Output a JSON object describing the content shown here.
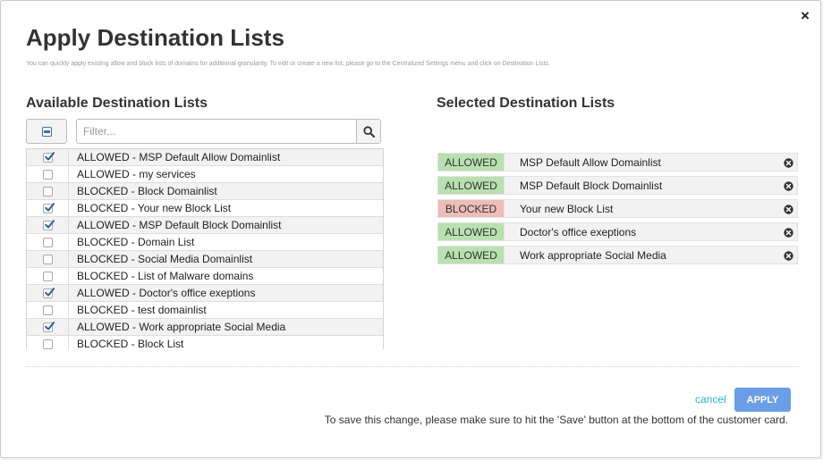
{
  "modal": {
    "title": "Apply Destination Lists",
    "subtitle": "You can quickly apply existing allow and block lists of domains for additional granularity. To edit or create a new list, please go to the Centralized Settings menu and click on Destination Lists.",
    "close_label": "×"
  },
  "available": {
    "heading": "Available Destination Lists",
    "filter_placeholder": "Filter...",
    "filter_value": "",
    "items": [
      {
        "label": "ALLOWED - MSP Default Allow Domainlist",
        "checked": true
      },
      {
        "label": "ALLOWED - my services",
        "checked": false
      },
      {
        "label": "BLOCKED - Block Domainlist",
        "checked": false
      },
      {
        "label": "BLOCKED - Your new Block List",
        "checked": true
      },
      {
        "label": "ALLOWED - MSP Default Block Domainlist",
        "checked": true
      },
      {
        "label": "BLOCKED - Domain List",
        "checked": false
      },
      {
        "label": "BLOCKED - Social Media Domainlist",
        "checked": false
      },
      {
        "label": "BLOCKED - List of Malware domains",
        "checked": false
      },
      {
        "label": "ALLOWED - Doctor's office exeptions",
        "checked": true
      },
      {
        "label": "BLOCKED - test domainlist",
        "checked": false
      },
      {
        "label": "ALLOWED - Work appropriate Social Media",
        "checked": true
      },
      {
        "label": "BLOCKED - Block List",
        "checked": false
      }
    ]
  },
  "selected": {
    "heading": "Selected Destination Lists",
    "items": [
      {
        "status": "ALLOWED",
        "name": "MSP Default Allow Domainlist"
      },
      {
        "status": "ALLOWED",
        "name": "MSP Default Block Domainlist"
      },
      {
        "status": "BLOCKED",
        "name": "Your new Block List"
      },
      {
        "status": "ALLOWED",
        "name": "Doctor's office exeptions"
      },
      {
        "status": "ALLOWED",
        "name": "Work appropriate Social Media"
      }
    ]
  },
  "footer": {
    "cancel_label": "cancel",
    "apply_label": "APPLY",
    "note": "To save this change, please make sure to hit the 'Save' button at the bottom of the customer card."
  },
  "colors": {
    "allowed_badge": "#b9e0b0",
    "blocked_badge": "#efbcb8",
    "apply_button": "#6b9ee6",
    "cancel_link": "#2ab3c9",
    "checkbox_check": "#2d5aa0"
  },
  "icons": {
    "close": "close-icon",
    "search": "search-icon",
    "select_all": "indeterminate-checkbox-icon",
    "remove": "remove-circle-icon"
  }
}
